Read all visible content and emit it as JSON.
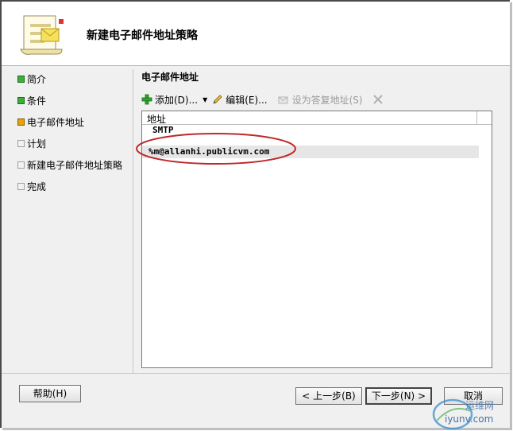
{
  "dialog": {
    "title": "新建电子邮件地址策略"
  },
  "nav": {
    "items": [
      {
        "label": "简介",
        "state": "done"
      },
      {
        "label": "条件",
        "state": "done"
      },
      {
        "label": "电子邮件地址",
        "state": "current"
      },
      {
        "label": "计划",
        "state": "todo"
      },
      {
        "label": "新建电子邮件地址策略",
        "state": "todo"
      },
      {
        "label": "完成",
        "state": "todo"
      }
    ]
  },
  "section": {
    "title": "电子邮件地址"
  },
  "toolbar": {
    "add_label": "添加(D)...",
    "edit_label": "编辑(E)...",
    "set_reply_label": "设为答复地址(S)"
  },
  "list": {
    "column_header": "地址",
    "group_label": "SMTP",
    "rows": [
      "%m@allanhi.publicvm.com"
    ]
  },
  "buttons": {
    "help": "帮助(H)",
    "back": "< 上一步(B)",
    "next": "下一步(N) >",
    "cancel": "取消"
  },
  "watermark": {
    "line1": "运维网",
    "line2": "iyunv.com"
  },
  "colors": {
    "annotation": "#c0282a",
    "done": "#3cae3c",
    "current": "#e8a20b"
  }
}
